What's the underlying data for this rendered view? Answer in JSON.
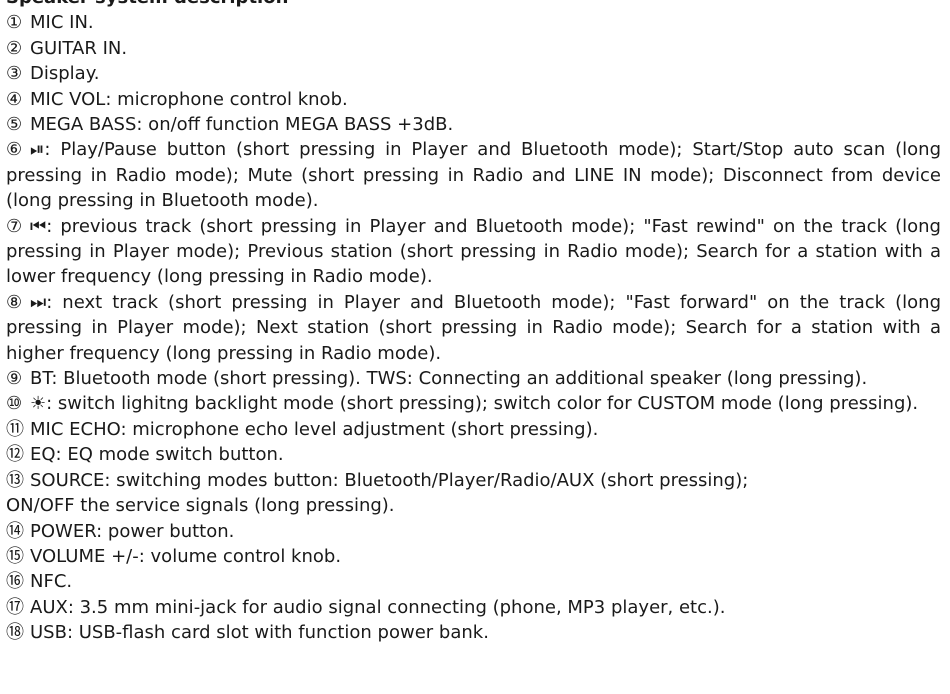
{
  "heading": "Speaker system description",
  "items": [
    {
      "num": "①",
      "text": "MIC IN."
    },
    {
      "num": "②",
      "text": "GUITAR IN."
    },
    {
      "num": "③",
      "text": "Display."
    },
    {
      "num": "④",
      "text": "MIC VOL: microphone control knob."
    },
    {
      "num": "⑤",
      "text": "MEGA BASS: on/off function MEGA BASS +3dB."
    },
    {
      "num": "⑥",
      "text": "⏯: Play/Pause button (short pressing in Player and Bluetooth mode); Start/Stop auto scan (long pressing in Radio mode); Mute (short pressing in Radio and LINE IN mode); Disconnect from device (long pressing in Bluetooth mode)."
    },
    {
      "num": "⑦",
      "text": "⏮: previous track (short pressing in Player and Bluetooth mode); \"Fast rewind\" on the track (long pressing in Player mode); Previous station (short pressing in Radio mode); Search for a station with a lower frequency (long pressing in Radio mode)."
    },
    {
      "num": "⑧",
      "text": "⏭: next track (short pressing in Player and Bluetooth mode); \"Fast forward\" on the track (long pressing in Player mode); Next station (short pressing in Radio mode); Search for a station with a higher frequency (long pressing in Radio mode)."
    },
    {
      "num": "⑨",
      "text": "BT: Bluetooth mode (short pressing). TWS: Connecting an additional speaker (long pressing)."
    },
    {
      "num": "⑩",
      "text": "☀: switch lighitng backlight mode (short pressing); switch color for CUSTOM mode (long pressing)."
    },
    {
      "num": "⑪",
      "text": "MIC ECHO: microphone echo level adjustment (short pressing)."
    },
    {
      "num": "⑫",
      "text": "EQ: EQ mode switch button."
    },
    {
      "num": "⑬",
      "text": "SOURCE: switching modes button: Bluetooth/Player/Radio/AUX (short pressing);"
    },
    {
      "num": "",
      "text": "ON/OFF the service signals (long pressing)."
    },
    {
      "num": "⑭",
      "text": "POWER: power button."
    },
    {
      "num": "⑮",
      "text": "VOLUME +/-: volume control knob."
    },
    {
      "num": "⑯",
      "text": "NFC."
    },
    {
      "num": "⑰",
      "text": "AUX: 3.5 mm mini-jack for audio signal connecting (phone, MP3 player, etc.)."
    },
    {
      "num": "⑱",
      "text": "USB: USB-flash card slot with function power bank."
    }
  ]
}
